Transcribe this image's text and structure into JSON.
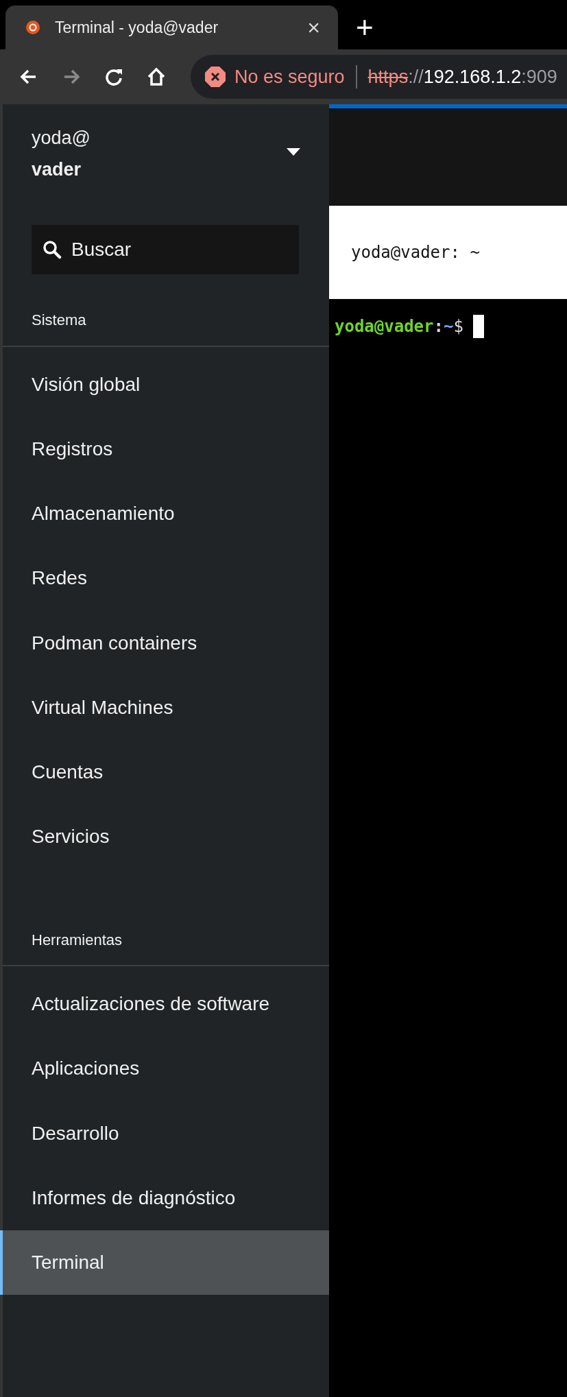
{
  "browser": {
    "tab": {
      "title": "Terminal - yoda@vader",
      "close": "×"
    },
    "new_tab": "+",
    "nav": [
      {
        "kind": "back",
        "disabled": false
      },
      {
        "kind": "forward",
        "disabled": true
      },
      {
        "kind": "reload",
        "disabled": false
      },
      {
        "kind": "home",
        "disabled": false
      }
    ],
    "address": {
      "security": "No es seguro",
      "scheme": "https",
      "separator": "://",
      "host": "192.168.1.2",
      "port": ":909"
    }
  },
  "sidebar": {
    "host": {
      "user": "yoda@",
      "name": "vader"
    },
    "search": {
      "placeholder": "Buscar"
    },
    "sections": [
      {
        "title": "Sistema",
        "items": [
          {
            "label": "Visión global",
            "selected": false
          },
          {
            "label": "Registros",
            "selected": false
          },
          {
            "label": "Almacenamiento",
            "selected": false
          },
          {
            "label": "Redes",
            "selected": false
          },
          {
            "label": "Podman containers",
            "selected": false
          },
          {
            "label": "Virtual Machines",
            "selected": false
          },
          {
            "label": "Cuentas",
            "selected": false
          },
          {
            "label": "Servicios",
            "selected": false
          }
        ]
      },
      {
        "title": "Herramientas",
        "items": [
          {
            "label": "Actualizaciones de software",
            "selected": false
          },
          {
            "label": "Aplicaciones",
            "selected": false
          },
          {
            "label": "Desarrollo",
            "selected": false
          },
          {
            "label": "Informes de diagnóstico",
            "selected": false
          },
          {
            "label": "Terminal",
            "selected": true
          }
        ]
      }
    ]
  },
  "main": {
    "title": "yoda@vader: ~",
    "prompt": {
      "user_host": "yoda@vader",
      "separator": ":",
      "path": "~",
      "symbol": "$"
    }
  }
}
